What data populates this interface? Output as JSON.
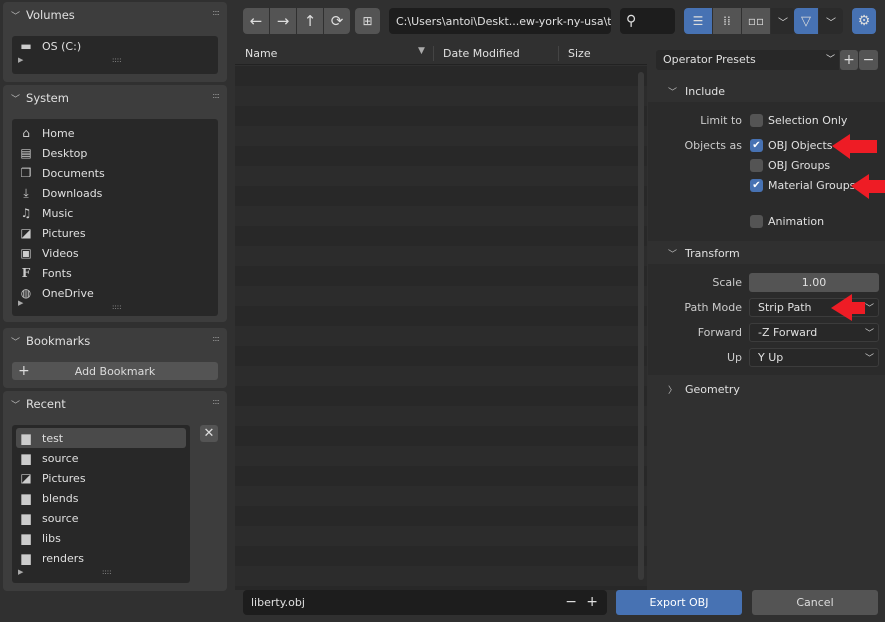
{
  "sidebar": {
    "volumes": {
      "title": "Volumes",
      "items": [
        {
          "label": "OS (C:)",
          "icon": "disk-icon"
        }
      ]
    },
    "system": {
      "title": "System",
      "items": [
        {
          "label": "Home",
          "icon": "home-icon"
        },
        {
          "label": "Desktop",
          "icon": "desktop-icon"
        },
        {
          "label": "Documents",
          "icon": "documents-icon"
        },
        {
          "label": "Downloads",
          "icon": "download-icon"
        },
        {
          "label": "Music",
          "icon": "music-icon"
        },
        {
          "label": "Pictures",
          "icon": "image-icon"
        },
        {
          "label": "Videos",
          "icon": "video-icon"
        },
        {
          "label": "Fonts",
          "icon": "font-icon"
        },
        {
          "label": "OneDrive",
          "icon": "network-icon"
        }
      ]
    },
    "bookmarks": {
      "title": "Bookmarks",
      "add_label": "Add Bookmark"
    },
    "recent": {
      "title": "Recent",
      "items": [
        {
          "label": "test",
          "icon": "folder-icon",
          "selected": true
        },
        {
          "label": "source",
          "icon": "folder-icon"
        },
        {
          "label": "Pictures",
          "icon": "image-icon"
        },
        {
          "label": "blends",
          "icon": "folder-icon"
        },
        {
          "label": "source",
          "icon": "folder-icon"
        },
        {
          "label": "libs",
          "icon": "folder-icon"
        },
        {
          "label": "renders",
          "icon": "folder-icon"
        }
      ]
    }
  },
  "toolbar": {
    "path": "C:\\Users\\antoi\\Deskt...ew-york-ny-usa\\test\\",
    "search_value": ""
  },
  "filelist": {
    "columns": [
      "Name",
      "Date Modified",
      "Size"
    ]
  },
  "options": {
    "presets": "Operator Presets",
    "include": {
      "title": "Include",
      "limit_label": "Limit to",
      "selection_only": "Selection Only",
      "selection_only_checked": false,
      "objects_as_label": "Objects as",
      "obj_objects": "OBJ Objects",
      "obj_objects_checked": true,
      "obj_groups": "OBJ Groups",
      "obj_groups_checked": false,
      "material_groups": "Material Groups",
      "material_groups_checked": true,
      "animation": "Animation",
      "animation_checked": false
    },
    "transform": {
      "title": "Transform",
      "scale_label": "Scale",
      "scale": "1.00",
      "path_mode_label": "Path Mode",
      "path_mode": "Strip Path",
      "forward_label": "Forward",
      "forward": "-Z Forward",
      "up_label": "Up",
      "up": "Y Up"
    },
    "geometry": {
      "title": "Geometry"
    }
  },
  "footer": {
    "filename": "liberty.obj",
    "export_label": "Export OBJ",
    "cancel_label": "Cancel"
  },
  "colors": {
    "accent": "#4772b3",
    "annotation_arrow": "#ee1c25"
  }
}
